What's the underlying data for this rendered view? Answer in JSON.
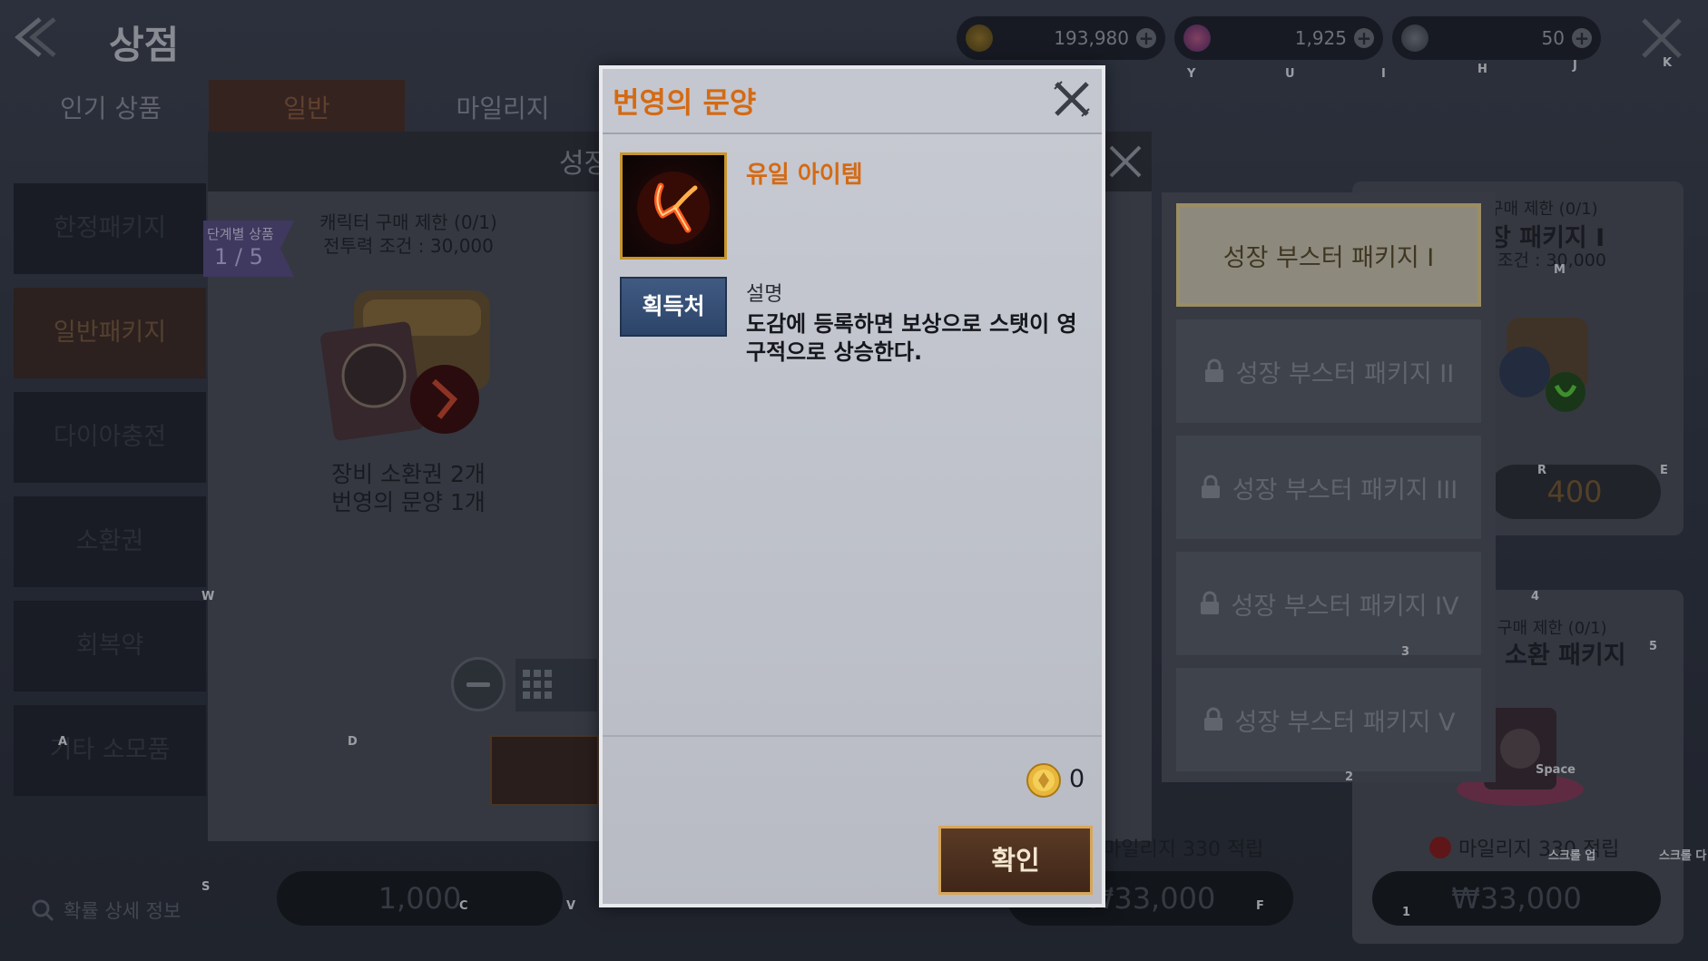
{
  "header": {
    "title": "상점",
    "currencies": [
      {
        "icon": "gold-coin-icon",
        "value": "193,980",
        "color": "#b08a30"
      },
      {
        "icon": "diamond-icon",
        "value": "1,925",
        "color": "#c04a7a"
      },
      {
        "icon": "mileage-gem-icon",
        "value": "50",
        "color": "#7a7f8a"
      }
    ]
  },
  "key_hints": {
    "y": "Y",
    "u": "U",
    "i": "I",
    "h": "H",
    "j": "J",
    "k": "K",
    "m": "M",
    "r": "R",
    "e": "E",
    "n4": "4",
    "n5": "5",
    "n3": "3",
    "n2": "2",
    "w": "W",
    "a": "A",
    "d": "D",
    "s": "S",
    "c": "C",
    "v": "V",
    "f": "F",
    "n1": "1",
    "space": "Space",
    "scroll_up": "스크롤 업",
    "scroll_down": "스크롤 다"
  },
  "top_tabs": [
    {
      "label": "인기 상품"
    },
    {
      "label": "일반",
      "active": true
    },
    {
      "label": "마일리지"
    }
  ],
  "sidebar": {
    "items": [
      {
        "label": "한정패키지"
      },
      {
        "label": "일반패키지",
        "active": true
      },
      {
        "label": "다이아충전"
      },
      {
        "label": "소환권"
      },
      {
        "label": "회복약"
      },
      {
        "label": "기타 소모품"
      }
    ],
    "search_label": "확률 상세 정보"
  },
  "panel2": {
    "title": "성장",
    "stage_badge": {
      "label": "단계별 상품",
      "value": "1 / 5"
    },
    "purchase_limit": "캐릭터 구매 제한 (0/1)",
    "power_condition": "전투력 조건 : 30,000",
    "contents_line1": "장비 소환권 2개",
    "contents_line2": "번영의 문양 1개"
  },
  "bottom_prices": [
    {
      "label": "1,000"
    },
    {
      "label": "₩33,000"
    },
    {
      "label": "₩33,000"
    }
  ],
  "right_cards": {
    "card1_limit": "구매 제한 (0/1)",
    "card1_title": "장 패키지 I",
    "card1_condition": "조건 : 30,000",
    "card1_price": "400",
    "card2_limit": "구매 제한 (0/1)",
    "card2_title": "소환 패키지",
    "card2_mileage": "마일리지 330 적립",
    "mileage_center": "마일리지 330 적립"
  },
  "tiers": [
    {
      "label": "성장 부스터 패키지 I",
      "active": true
    },
    {
      "label": "성장 부스터 패키지 II",
      "locked": true
    },
    {
      "label": "성장 부스터 패키지 III",
      "locked": true
    },
    {
      "label": "성장 부스터 패키지 IV",
      "locked": true
    },
    {
      "label": "성장 부스터 패키지 V",
      "locked": true
    }
  ],
  "modal": {
    "title": "번영의 문양",
    "rarity": "유일 아이템",
    "source_button": "획득처",
    "desc_label": "설명",
    "desc_text": "도감에 등록하면 보상으로 스탯이 영구적으로 상승한다.",
    "cost": "0",
    "confirm": "확인",
    "accent_color": "#d46a14"
  }
}
